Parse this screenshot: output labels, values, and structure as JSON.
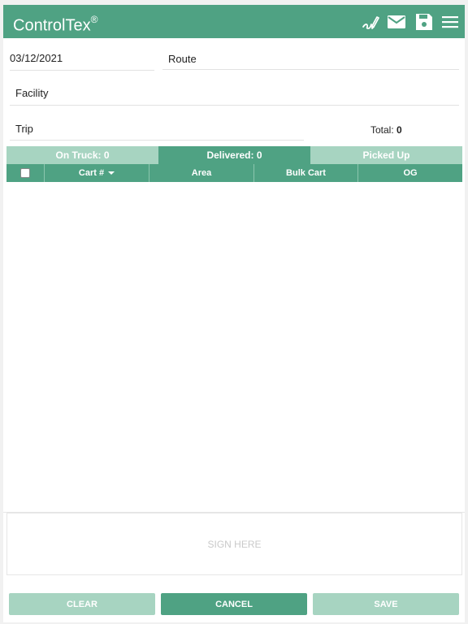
{
  "app": {
    "title": "ControlTex",
    "mark": "®"
  },
  "header_icons": [
    "signature-icon",
    "mail-icon",
    "save-icon",
    "menu-icon"
  ],
  "form": {
    "date": "03/12/2021",
    "route": "Route",
    "facility": "Facility",
    "trip": "Trip",
    "total_label": "Total:",
    "total_value": "0"
  },
  "tabs": [
    {
      "label": "On Truck: 0",
      "state": "inactive"
    },
    {
      "label": "Delivered: 0",
      "state": "active"
    },
    {
      "label": "Picked Up",
      "state": "inactive"
    }
  ],
  "table": {
    "columns": [
      "Cart #",
      "Area",
      "Bulk Cart",
      "OG"
    ],
    "rows": []
  },
  "signature": {
    "placeholder": "SIGN HERE"
  },
  "buttons": {
    "clear": "CLEAR",
    "cancel": "CANCEL",
    "save": "SAVE"
  },
  "colors": {
    "primary": "#4fa283",
    "light": "#a7d4c1"
  }
}
